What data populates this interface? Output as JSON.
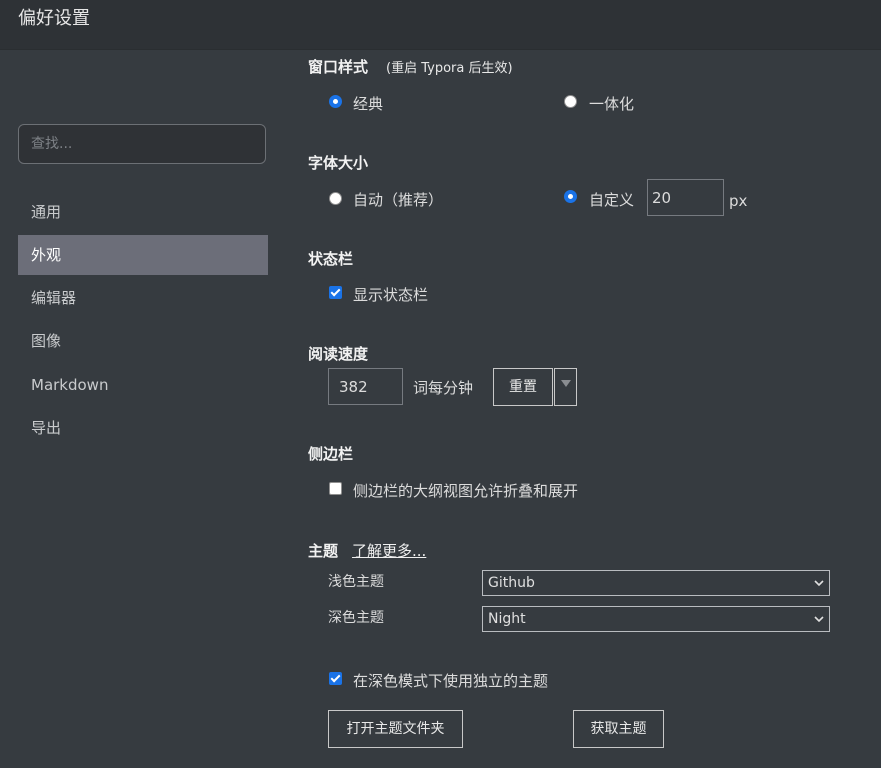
{
  "window": {
    "title": "偏好设置"
  },
  "sidebar": {
    "search_placeholder": "查找...",
    "items": [
      {
        "label": "通用"
      },
      {
        "label": "外观"
      },
      {
        "label": "编辑器"
      },
      {
        "label": "图像"
      },
      {
        "label": "Markdown"
      },
      {
        "label": "导出"
      }
    ],
    "active_index": 1
  },
  "window_style": {
    "heading": "窗口样式",
    "note": "(重启 Typora 后生效)",
    "options": [
      "经典",
      "一体化"
    ],
    "selected": "经典"
  },
  "font_size": {
    "heading": "字体大小",
    "auto_label": "自动（推荐）",
    "custom_label": "自定义",
    "selected": "自定义",
    "value": "20",
    "unit": "px"
  },
  "status_bar": {
    "heading": "状态栏",
    "show_label": "显示状态栏",
    "show_checked": true
  },
  "reading_speed": {
    "heading": "阅读速度",
    "value": "382",
    "unit_label": "词每分钟",
    "reset_label": "重置",
    "dropdown_icon": "triangle-down-icon"
  },
  "sidebar_section": {
    "heading": "侧边栏",
    "collapse_label": "侧边栏的大纲视图允许折叠和展开",
    "collapse_checked": false
  },
  "theme": {
    "heading": "主题",
    "learn_more": "了解更多...",
    "light_label": "浅色主题",
    "light_value": "Github",
    "dark_label": "深色主题",
    "dark_value": "Night",
    "separate_label": "在深色模式下使用独立的主题",
    "separate_checked": true,
    "open_folder_label": "打开主题文件夹",
    "get_themes_label": "获取主题"
  },
  "colors": {
    "background": "#363b40",
    "titlebar": "#2e3236",
    "active_nav": "#6c6e79",
    "accent": "#1a73e8"
  }
}
